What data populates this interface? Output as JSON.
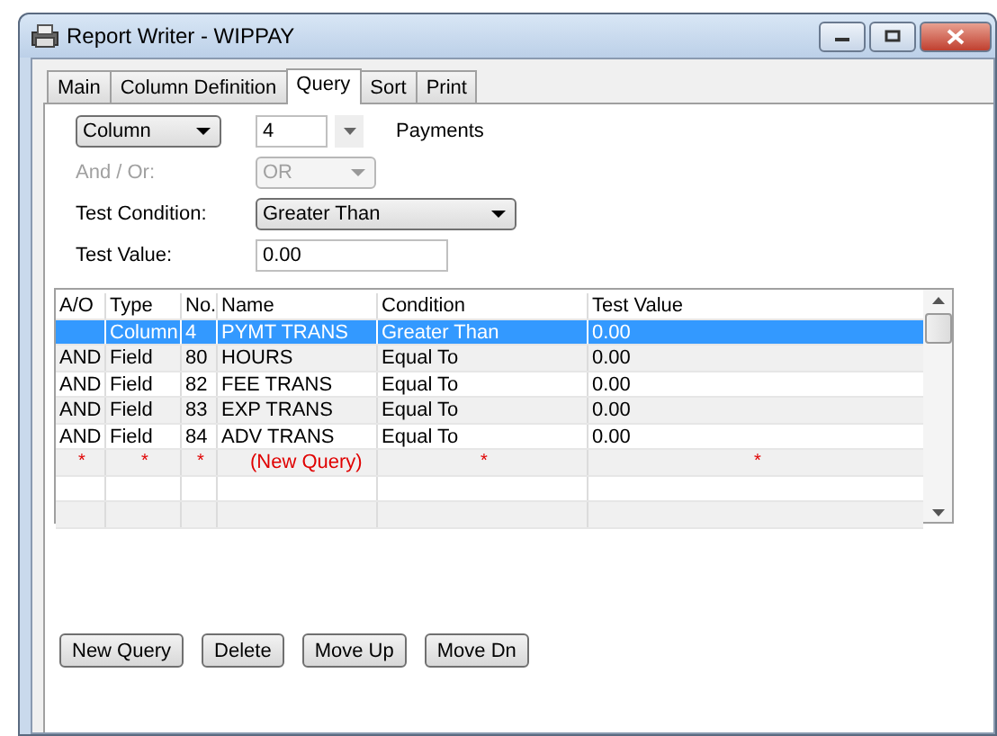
{
  "window": {
    "title": "Report Writer - WIPPAY"
  },
  "tabs": [
    {
      "label": "Main",
      "selected": false
    },
    {
      "label": "Column Definition",
      "selected": false
    },
    {
      "label": "Query",
      "selected": true
    },
    {
      "label": "Sort",
      "selected": false
    },
    {
      "label": "Print",
      "selected": false
    }
  ],
  "query_form": {
    "source": {
      "value": "Column"
    },
    "number": {
      "value": "4"
    },
    "source_name": "Payments",
    "and_or": {
      "label": "And / Or:",
      "value": "OR",
      "disabled": true
    },
    "test_condition": {
      "label": "Test Condition:",
      "value": "Greater Than"
    },
    "test_value": {
      "label": "Test Value:",
      "value": "0.00"
    }
  },
  "table": {
    "columns": [
      "A/O",
      "Type",
      "No.",
      "Name",
      "Condition",
      "Test Value"
    ],
    "rows": [
      {
        "kind": "query",
        "cells": [
          "",
          "Column",
          "4",
          "PYMT TRANS",
          "Greater Than",
          "0.00"
        ],
        "selected": true
      },
      {
        "kind": "query",
        "cells": [
          "AND",
          "Field",
          "80",
          "HOURS",
          "Equal To",
          "0.00"
        ],
        "selected": false
      },
      {
        "kind": "query",
        "cells": [
          "AND",
          "Field",
          "82",
          "FEE TRANS",
          "Equal To",
          "0.00"
        ],
        "selected": false
      },
      {
        "kind": "query",
        "cells": [
          "AND",
          "Field",
          "83",
          "EXP TRANS",
          "Equal To",
          "0.00"
        ],
        "selected": false
      },
      {
        "kind": "query",
        "cells": [
          "AND",
          "Field",
          "84",
          "ADV TRANS",
          "Equal To",
          "0.00"
        ],
        "selected": false
      },
      {
        "kind": "new",
        "cells": [
          "*",
          "*",
          "*",
          "(New Query)",
          "*",
          "*"
        ],
        "selected": false
      }
    ]
  },
  "buttons": [
    "New Query",
    "Delete",
    "Move Up",
    "Move Dn"
  ]
}
